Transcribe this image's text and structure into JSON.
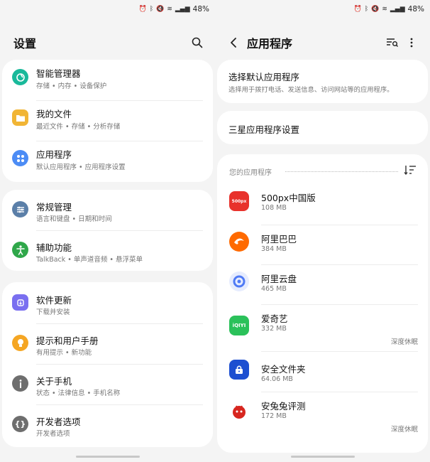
{
  "status_bar": {
    "battery": "48%"
  },
  "settings": {
    "title": "设置",
    "groups": [
      [
        {
          "name": "device-care",
          "title": "智能管理器",
          "subtitle": "存储 • 内存 • 设备保护",
          "color": "#19b99a",
          "icon": "device-care-icon"
        },
        {
          "name": "my-files",
          "title": "我的文件",
          "subtitle": "最近文件 • 存储 • 分析存储",
          "color": "#f1b535",
          "icon": "folder-icon"
        },
        {
          "name": "apps",
          "title": "应用程序",
          "subtitle": "默认应用程序 • 应用程序设置",
          "color": "#4c8cf5",
          "icon": "apps-grid-icon"
        }
      ],
      [
        {
          "name": "general-management",
          "title": "常规管理",
          "subtitle": "语言和键盘 • 日期和时间",
          "color": "#5b7fa8",
          "icon": "sliders-icon"
        },
        {
          "name": "accessibility",
          "title": "辅助功能",
          "subtitle": "TalkBack • 单声道音频 • 悬浮菜单",
          "color": "#2fa74a",
          "icon": "accessibility-icon"
        }
      ],
      [
        {
          "name": "software-update",
          "title": "软件更新",
          "subtitle": "下载并安装",
          "color": "#7a6ff0",
          "icon": "update-icon"
        },
        {
          "name": "tips-manual",
          "title": "提示和用户手册",
          "subtitle": "有用提示 • 新功能",
          "color": "#f5a623",
          "icon": "lightbulb-icon"
        },
        {
          "name": "about-phone",
          "title": "关于手机",
          "subtitle": "状态 • 法律信息 • 手机名称",
          "color": "#6e6e6e",
          "icon": "info-icon"
        },
        {
          "name": "developer-options",
          "title": "开发者选项",
          "subtitle": "开发者选项",
          "color": "#6e6e6e",
          "icon": "braces-icon"
        }
      ]
    ]
  },
  "apps_page": {
    "title": "应用程序",
    "default_apps": {
      "title": "选择默认应用程序",
      "subtitle": "选择用于拨打电话、发送信息、访问网站等的应用程序。"
    },
    "samsung_settings": {
      "title": "三星应用程序设置"
    },
    "your_apps_label": "您的应用程序",
    "apps": [
      {
        "name": "500px中国版",
        "size": "108 MB",
        "tag": "",
        "color": "#e8322c",
        "icon": "500px-app-icon",
        "icon_text": "500px"
      },
      {
        "name": "阿里巴巴",
        "size": "384 MB",
        "tag": "",
        "color": "#ff6a00",
        "icon": "alibaba-app-icon",
        "icon_text": ""
      },
      {
        "name": "阿里云盘",
        "size": "465 MB",
        "tag": "",
        "color": "#4f7af5",
        "icon": "aliyun-drive-app-icon",
        "icon_text": ""
      },
      {
        "name": "爱奇艺",
        "size": "332 MB",
        "tag": "深度休眠",
        "color": "#2bc15a",
        "icon": "iqiyi-app-icon",
        "icon_text": "iQIYI"
      },
      {
        "name": "安全文件夹",
        "size": "64.06 MB",
        "tag": "",
        "color": "#1d4fd1",
        "icon": "secure-folder-app-icon",
        "icon_text": ""
      },
      {
        "name": "安兔兔评测",
        "size": "172 MB",
        "tag": "深度休眠",
        "color": "#d7261f",
        "icon": "antutu-app-icon",
        "icon_text": ""
      }
    ]
  }
}
